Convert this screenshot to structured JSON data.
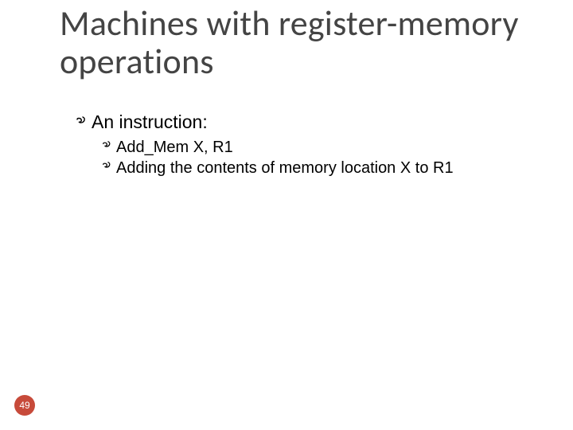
{
  "title": "Machines with register-memory operations",
  "bullets": {
    "l1": "An instruction:",
    "l2a": "Add_Mem X, R1",
    "l2b": "Adding the contents of memory location X to R1"
  },
  "page": "49"
}
